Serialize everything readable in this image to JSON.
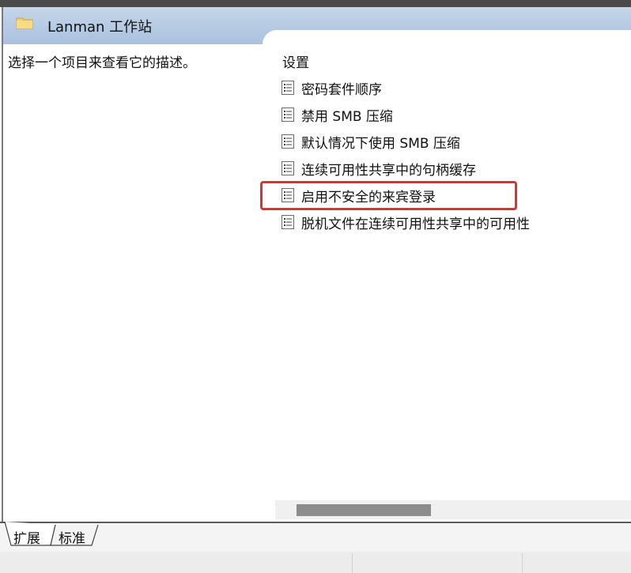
{
  "header": {
    "title": "Lanman 工作站",
    "icon": "folder-icon"
  },
  "description": {
    "text": "选择一个项目来查看它的描述。"
  },
  "list": {
    "column_header": "设置",
    "items": [
      {
        "label": "密码套件顺序"
      },
      {
        "label": "禁用 SMB 压缩"
      },
      {
        "label": "默认情况下使用 SMB 压缩"
      },
      {
        "label": "连续可用性共享中的句柄缓存"
      },
      {
        "label": "启用不安全的来宾登录"
      },
      {
        "label": "脱机文件在连续可用性共享中的可用性"
      }
    ],
    "highlighted_index": 4,
    "highlight_color": "#e03030"
  },
  "tabs": [
    {
      "label": "扩展"
    },
    {
      "label": "标准"
    }
  ]
}
